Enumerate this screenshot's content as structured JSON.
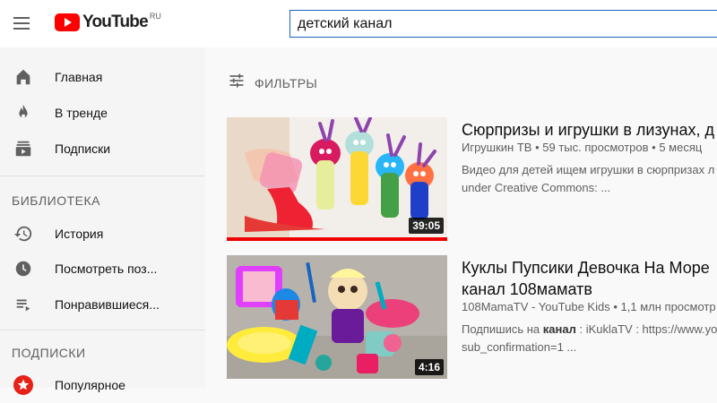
{
  "header": {
    "logo_text": "YouTube",
    "logo_region": "RU",
    "search_value": "детский канал"
  },
  "sidebar": {
    "main_items": [
      {
        "label": "Главная",
        "icon": "home-icon"
      },
      {
        "label": "В тренде",
        "icon": "flame-icon"
      },
      {
        "label": "Подписки",
        "icon": "subscriptions-icon"
      }
    ],
    "library_title": "БИБЛИОТЕКА",
    "library_items": [
      {
        "label": "История",
        "icon": "history-icon"
      },
      {
        "label": "Посмотреть поз...",
        "icon": "clock-icon"
      },
      {
        "label": "Понравившиеся...",
        "icon": "playlist-icon"
      }
    ],
    "subscriptions_title": "ПОДПИСКИ",
    "subscription_items": [
      {
        "label": "Популярное",
        "icon": "popular-channel-icon"
      }
    ]
  },
  "main": {
    "filter_label": "ФИЛЬТРЫ",
    "videos": [
      {
        "title": "Сюрпризы и игрушки в лизунах, д",
        "channel": "Игрушкин ТВ",
        "views": "59 тыс. просмотров",
        "age": "5 месяц",
        "desc_line1": "Видео для детей ищем игрушки в сюрпризах л",
        "desc_line2": "under Creative Commons: ...",
        "duration": "39:05",
        "watched_fraction": 1.0
      },
      {
        "title_line1": "Куклы Пупсики Девочка На Море",
        "title_line2": "канал 108маматв",
        "channel": "108MamaTV - YouTube Kids",
        "views": "1,1 млн просмотр",
        "desc_prefix": "Подпишись на ",
        "desc_bold": "канал",
        "desc_suffix": " : iKuklaTV : https://www.yo",
        "desc_line2": "sub_confirmation=1 ...",
        "duration": "4:16"
      }
    ]
  },
  "colors": {
    "brand_red": "#ff0000",
    "search_border": "#1c62b9",
    "sidebar_bg": "#f5f5f5"
  }
}
